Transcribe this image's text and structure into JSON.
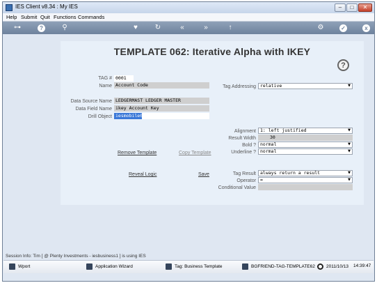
{
  "window": {
    "title": "IES Client v8.34 : My IES",
    "controls": {
      "minimize": "–",
      "maximize": "□",
      "close": "✕"
    }
  },
  "menu": [
    "Help",
    "Submit",
    "Quit",
    "Functions",
    "Commands"
  ],
  "toolbar": {
    "icons": [
      "key-icon",
      "help-icon",
      "search-icon",
      "heart-icon",
      "refresh-icon",
      "rewind-icon",
      "fast-forward-icon",
      "up-icon",
      "settings-icon",
      "ok-icon",
      "close-icon"
    ],
    "glyphs": {
      "key": "⊶",
      "help": "?",
      "search": "⚲",
      "heart": "♥",
      "refresh": "↻",
      "rewind": "«",
      "ffwd": "»",
      "up": "↑",
      "settings": "⚙",
      "ok": "✓",
      "close": "x"
    }
  },
  "page": {
    "heading": "TEMPLATE 062: Iterative  Alpha with IKEY",
    "help_glyph": "?"
  },
  "form": {
    "tag_label": "TAG #",
    "tag_value": "0001",
    "name_label": "Name",
    "name_value": "Account Code",
    "data_source_label": "Data Source Name",
    "data_source_value": "LEDGERMAST LEDGER MASTER",
    "data_field_label": "Data Field Name",
    "data_field_value": "ikey Account Key",
    "drill_object_label": "Drill Object",
    "drill_object_value": "iesmobile05",
    "tag_addressing_label": "Tag Addressing",
    "tag_addressing_value": "relative",
    "alignment_label": "Alignment",
    "alignment_value": "1: left justified",
    "result_width_label": "Result Width",
    "result_width_value": "30",
    "bold_label": "Bold ?",
    "bold_value": "normal",
    "underline_label": "Underline ?",
    "underline_value": "normal",
    "tag_result_label": "Tag Result",
    "tag_result_value": "always return a result",
    "operator_label": "Operator",
    "operator_value": "=",
    "conditional_value_label": "Conditional Value",
    "conditional_value_value": "",
    "dropdown_arrow": "▼"
  },
  "links": {
    "remove_template": "Remove Template",
    "copy_template": "Copy Template",
    "reveal_logic": "Reveal Logic",
    "save": "Save"
  },
  "status": "Session Info: Tim [ @ Plenty Investments  - iesbusiness1 ] is using IES",
  "taskbar": [
    {
      "label": "Wport",
      "icon": "document-icon"
    },
    {
      "label": "Application Wizard",
      "icon": "wizard-icon"
    },
    {
      "label": "Tag: Business Template",
      "icon": "tag-icon"
    },
    {
      "label": "BGFRIEND-TAG-TEMPLATE62",
      "icon": "template-icon"
    },
    {
      "label": "2011/10/13",
      "icon": "clock-icon"
    },
    {
      "label": "14:39:47",
      "icon": ""
    }
  ]
}
